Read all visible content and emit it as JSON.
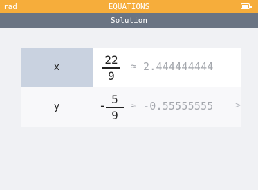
{
  "status_bar": {
    "angle_mode": "rad",
    "title": "EQUATIONS",
    "icon": "battery-icon",
    "color": "#f6ad3b"
  },
  "subheader": {
    "title": "Solution",
    "color": "#6a7483"
  },
  "solutions": [
    {
      "variable": "x",
      "sign": "",
      "numerator": "22",
      "denominator": "9",
      "approx_symbol": "≈",
      "decimal": "2.444444444",
      "selected": true
    },
    {
      "variable": "y",
      "sign": "-",
      "numerator": "5",
      "denominator": "9",
      "approx_symbol": "≈",
      "decimal": "-0.55555555",
      "more_icon": "chevron-right-icon",
      "more_glyph": ">"
    }
  ]
}
